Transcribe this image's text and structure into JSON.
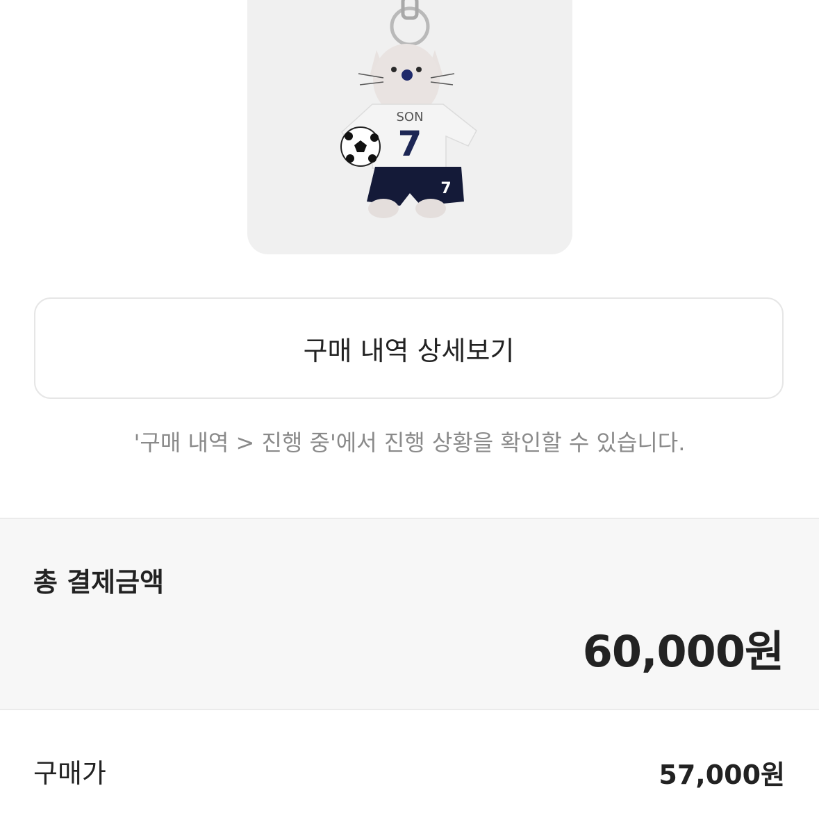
{
  "product": {
    "image_alt": "Plush cat keyring wearing white SON 7 jersey, navy shorts, holding a soccer ball",
    "jersey_name": "SON",
    "jersey_number": "7"
  },
  "actions": {
    "detail_button_label": "구매 내역 상세보기"
  },
  "notice_text": "'구매 내역 > 진행 중'에서 진행 상황을 확인할 수 있습니다.",
  "total": {
    "label": "총 결제금액",
    "amount": "60,000원"
  },
  "breakdown": [
    {
      "label": "구매가",
      "value": "57,000원"
    }
  ]
}
